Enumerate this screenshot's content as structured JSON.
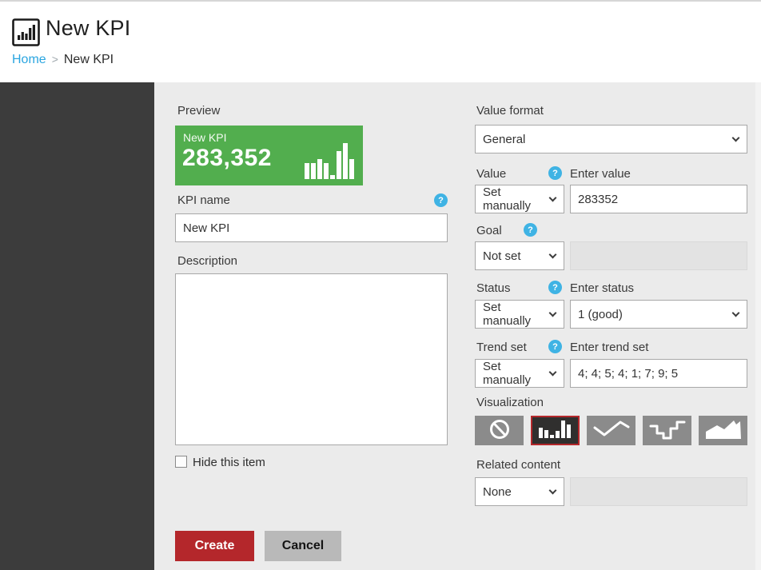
{
  "header": {
    "title": "New KPI",
    "breadcrumb": {
      "home": "Home",
      "separator": ">",
      "current": "New KPI"
    }
  },
  "icons": {
    "help_glyph": "?"
  },
  "preview": {
    "label": "Preview",
    "card_title": "New KPI",
    "card_value": "283,352",
    "card_color": "#52ae4e",
    "trend_bars": [
      4,
      4,
      5,
      4,
      1,
      7,
      9,
      5
    ]
  },
  "form": {
    "kpi_name": {
      "label": "KPI name",
      "value": "New KPI"
    },
    "description": {
      "label": "Description",
      "value": ""
    },
    "hide_item": {
      "label": "Hide this item",
      "checked": false
    },
    "value_format": {
      "label": "Value format",
      "selected": "General"
    },
    "value": {
      "label": "Value",
      "mode": "Set manually",
      "enter_label": "Enter value",
      "value": "283352"
    },
    "goal": {
      "label": "Goal",
      "mode": "Not set",
      "value": ""
    },
    "status": {
      "label": "Status",
      "mode": "Set manually",
      "enter_label": "Enter status",
      "value": "1 (good)"
    },
    "trend_set": {
      "label": "Trend set",
      "mode": "Set manually",
      "enter_label": "Enter trend set",
      "value": "4; 4; 5; 4; 1; 7; 9; 5"
    },
    "visualization": {
      "label": "Visualization",
      "options": [
        "none",
        "bar",
        "line",
        "step",
        "area"
      ],
      "selected": "bar"
    },
    "related_content": {
      "label": "Related content",
      "mode": "None",
      "value": ""
    }
  },
  "buttons": {
    "create": "Create",
    "cancel": "Cancel"
  },
  "colors": {
    "accent_green": "#52ae4e",
    "accent_red": "#b4272b",
    "help_blue": "#3fb3e4",
    "link_blue": "#2aa5e0",
    "sidebar": "#3c3c3c",
    "content_bg": "#ebebeb"
  }
}
